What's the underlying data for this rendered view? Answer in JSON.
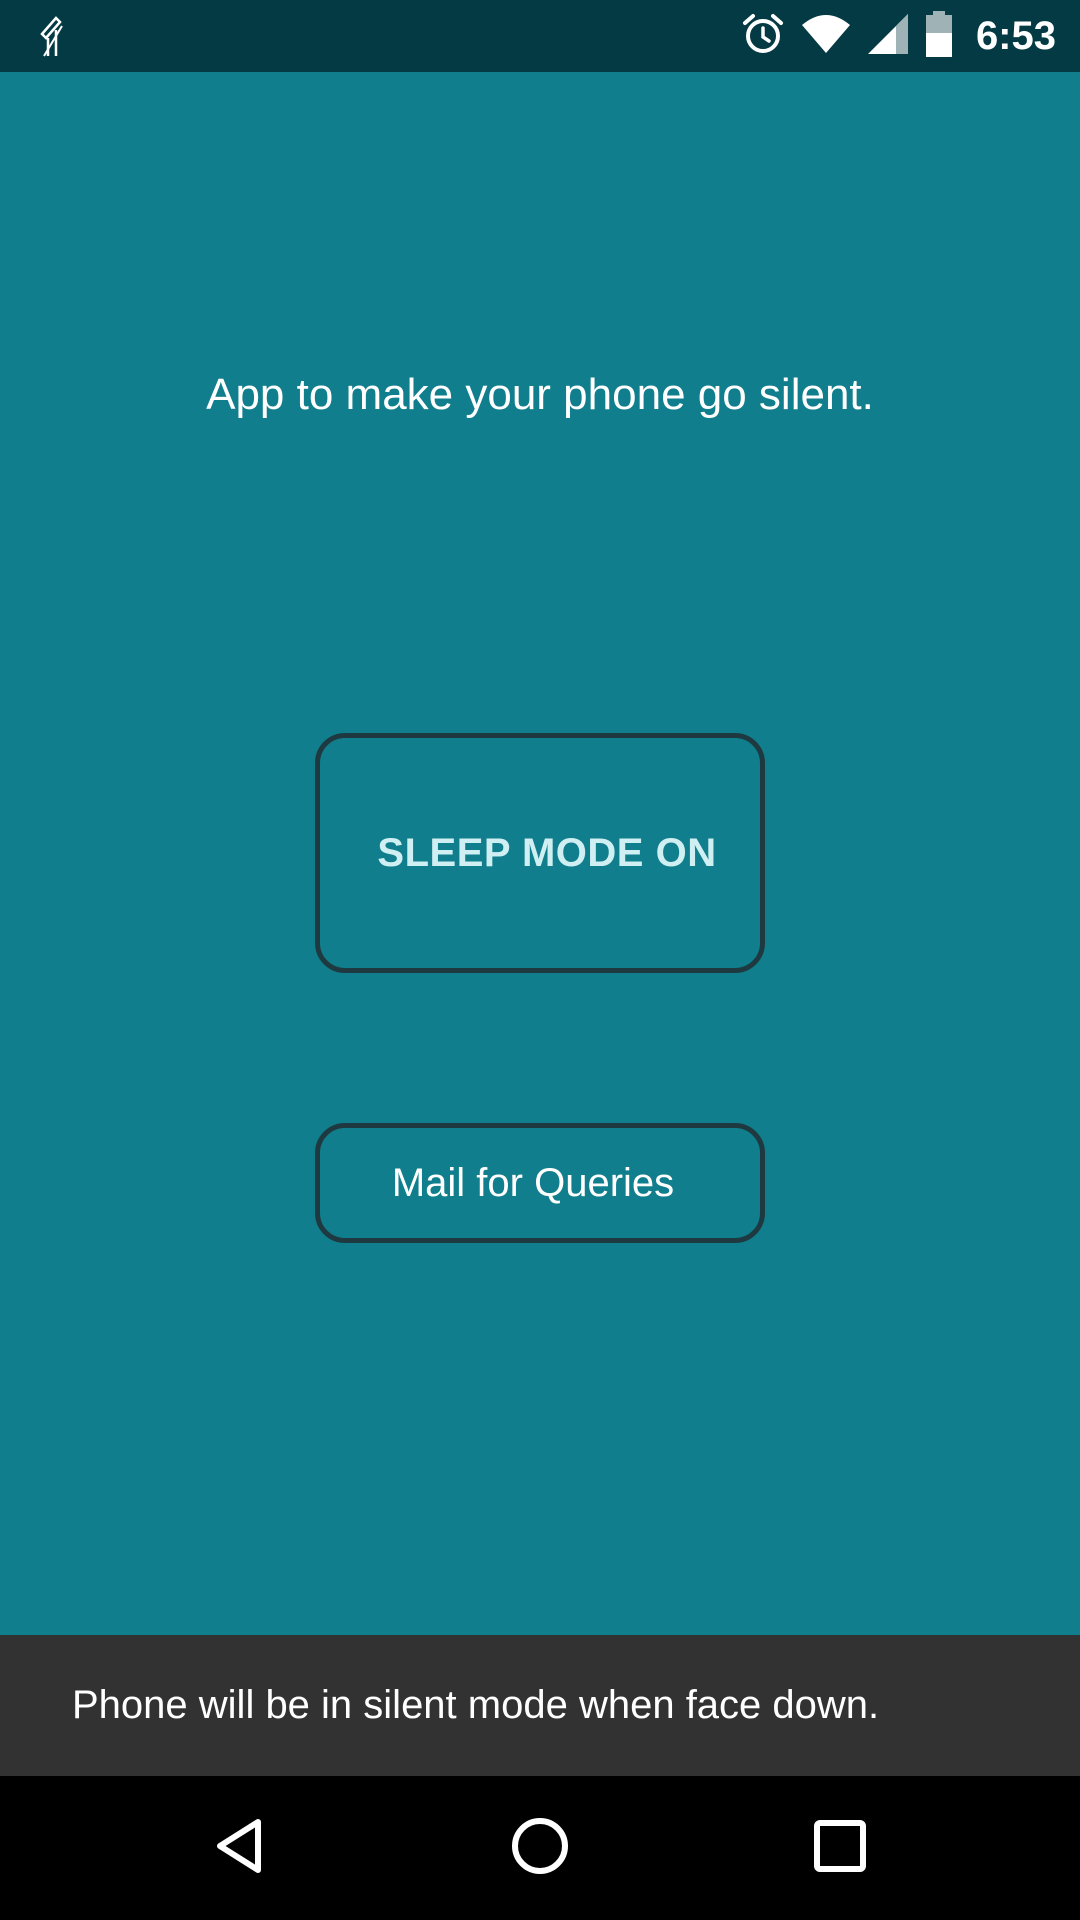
{
  "status_bar": {
    "time": "6:53",
    "icons": [
      "app-notification-icon",
      "alarm-icon",
      "wifi-icon",
      "cell-signal-icon",
      "battery-icon"
    ]
  },
  "main": {
    "tagline": "App to make your phone go silent.",
    "sleep_button_label": "SLEEP MODE ON",
    "mail_button_label": "Mail for Queries"
  },
  "snackbar": {
    "message": "Phone will be in silent mode when face down."
  },
  "nav_bar": {
    "buttons": [
      "back-icon",
      "home-icon",
      "recents-icon"
    ]
  },
  "colors": {
    "background": "#107e8c",
    "status_bar": "#043a44",
    "button_border": "#1e3a40",
    "snackbar": "#323232"
  }
}
